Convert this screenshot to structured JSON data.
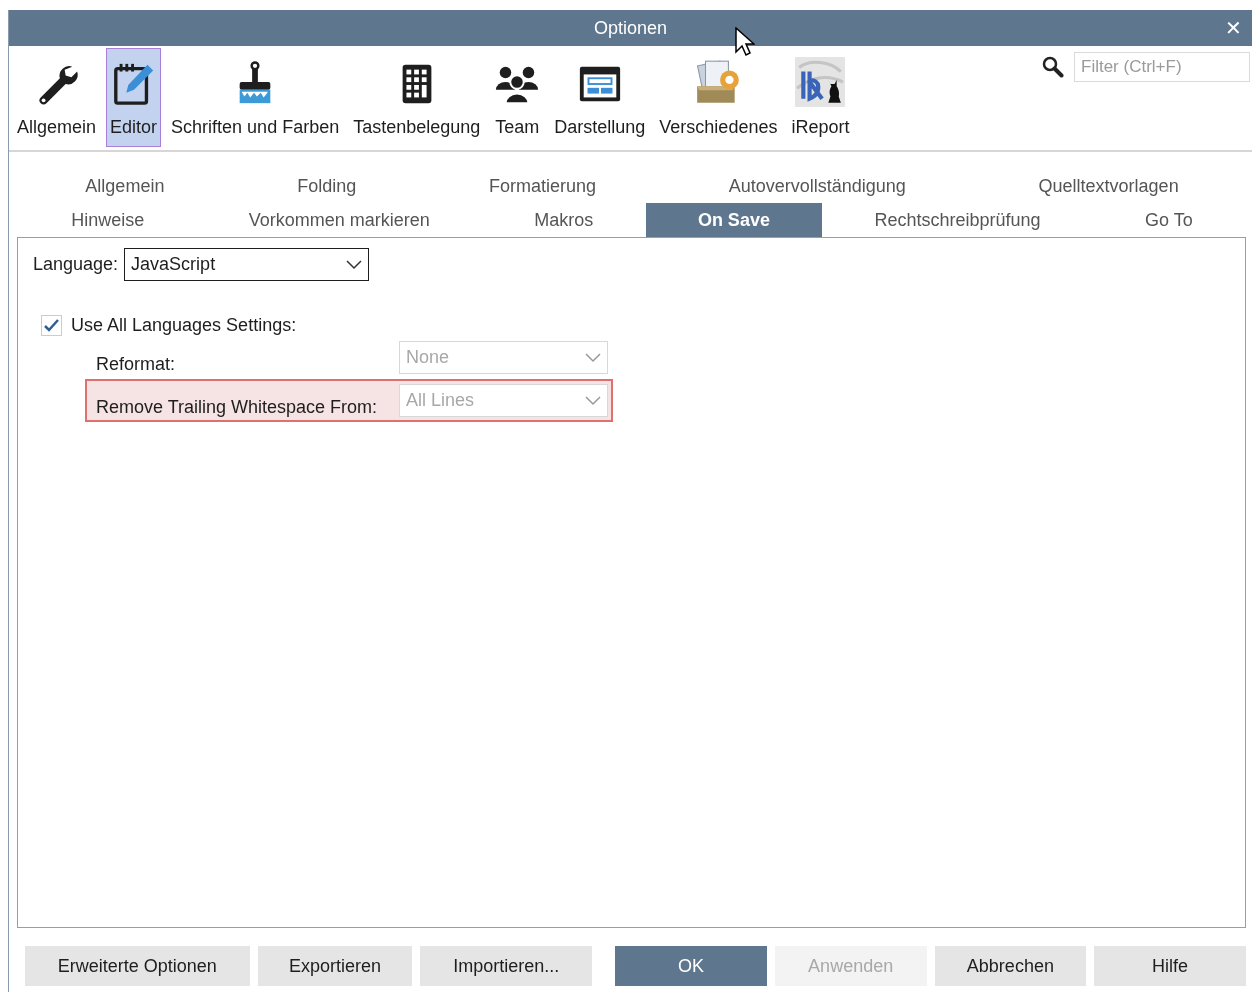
{
  "window": {
    "title": "Optionen",
    "close": "✕"
  },
  "toolbar": {
    "categories": [
      {
        "label": "Allgemein",
        "selected": false
      },
      {
        "label": "Editor",
        "selected": true
      },
      {
        "label": "Schriften und Farben",
        "selected": false
      },
      {
        "label": "Tastenbelegung",
        "selected": false
      },
      {
        "label": "Team",
        "selected": false
      },
      {
        "label": "Darstellung",
        "selected": false
      },
      {
        "label": "Verschiedenes",
        "selected": false
      },
      {
        "label": "iReport",
        "selected": false
      }
    ],
    "filter": {
      "placeholder": "Filter (Ctrl+F)"
    }
  },
  "subtabs": [
    [
      {
        "label": "Allgemein",
        "selected": false
      },
      {
        "label": "Folding",
        "selected": false
      },
      {
        "label": "Formatierung",
        "selected": false
      },
      {
        "label": "Autovervollständigung",
        "selected": false
      },
      {
        "label": "Quelltextvorlagen",
        "selected": false
      }
    ],
    [
      {
        "label": "Hinweise",
        "selected": false
      },
      {
        "label": "Vorkommen markieren",
        "selected": false
      },
      {
        "label": "Makros",
        "selected": false
      },
      {
        "label": "On Save",
        "selected": true
      },
      {
        "label": "Rechtschreibprüfung",
        "selected": false
      },
      {
        "label": "Go To",
        "selected": false
      }
    ]
  ],
  "settings": {
    "language": {
      "label": "Language:",
      "value": "JavaScript"
    },
    "use_all": {
      "label": "Use All Languages Settings:",
      "checked": true
    },
    "reformat": {
      "label": "Reformat:",
      "value": "None",
      "disabled": true,
      "highlighted": false
    },
    "remove_trailing": {
      "label": "Remove Trailing Whitespace From:",
      "value": "All Lines",
      "disabled": true,
      "highlighted": true
    }
  },
  "buttons": [
    {
      "label": "Erweiterte Optionen",
      "default": false,
      "disabled": false
    },
    {
      "label": "Exportieren",
      "default": false,
      "disabled": false
    },
    {
      "label": "Importieren...",
      "default": false,
      "disabled": false
    },
    {
      "label": "OK",
      "default": true,
      "disabled": false
    },
    {
      "label": "Anwenden",
      "default": false,
      "disabled": true
    },
    {
      "label": "Abbrechen",
      "default": false,
      "disabled": false
    },
    {
      "label": "Hilfe",
      "default": false,
      "disabled": false
    }
  ]
}
